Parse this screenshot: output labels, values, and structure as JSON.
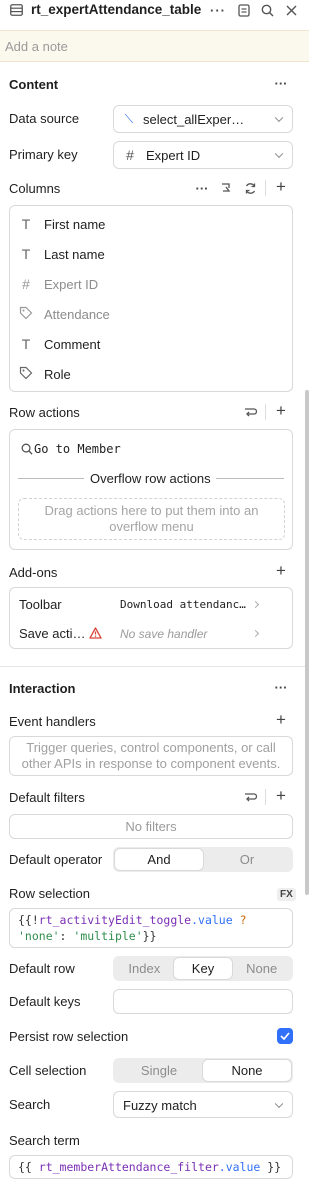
{
  "header": {
    "title": "rt_expertAttendance_table",
    "note_placeholder": "Add a note"
  },
  "content": {
    "section_title": "Content",
    "data_source": {
      "label": "Data source",
      "value": "select_allExper…"
    },
    "primary_key": {
      "label": "Primary key",
      "value": "Expert ID"
    },
    "columns": {
      "label": "Columns",
      "items": [
        {
          "type_icon": "T",
          "name": "First name",
          "muted": false
        },
        {
          "type_icon": "T",
          "name": "Last name",
          "muted": false
        },
        {
          "type_icon": "#",
          "name": "Expert ID",
          "muted": true
        },
        {
          "type_icon": "tag",
          "name": "Attendance",
          "muted": true
        },
        {
          "type_icon": "T",
          "name": "Comment",
          "muted": false
        },
        {
          "type_icon": "tag",
          "name": "Role",
          "muted": false
        }
      ]
    },
    "row_actions": {
      "label": "Row actions",
      "action": "Go to Member",
      "overflow_label": "Overflow row actions",
      "drop_hint": "Drag actions here to put them into an overflow menu"
    },
    "addons": {
      "label": "Add-ons",
      "toolbar": {
        "label": "Toolbar",
        "value": "Download attendanc…"
      },
      "save_actions": {
        "label": "Save acti…",
        "value": "No save handler"
      }
    }
  },
  "interaction": {
    "section_title": "Interaction",
    "event_handlers": {
      "label": "Event handlers",
      "hint": "Trigger queries, control components, or call other APIs in response to component events."
    },
    "default_filters": {
      "label": "Default filters",
      "value": "No filters"
    },
    "default_operator": {
      "label": "Default operator",
      "options": [
        "And",
        "Or"
      ],
      "selected": "And"
    },
    "row_selection": {
      "label": "Row selection",
      "fx": "FX",
      "code_line1_a": "{{!",
      "code_line1_b": "rt_activityEdit_toggle",
      "code_line1_c": ".value",
      "code_line1_d": " ?",
      "code_line2_a": "'none'",
      "code_line2_b": ": ",
      "code_line2_c": "'multiple'",
      "code_line2_d": "}}"
    },
    "default_row": {
      "label": "Default row",
      "options": [
        "Index",
        "Key",
        "None"
      ],
      "selected": "Key"
    },
    "default_keys": {
      "label": "Default keys",
      "value": ""
    },
    "persist_row_selection": {
      "label": "Persist row selection",
      "checked": true
    },
    "cell_selection": {
      "label": "Cell selection",
      "options": [
        "Single",
        "None"
      ],
      "selected": "None"
    },
    "search": {
      "label": "Search",
      "value": "Fuzzy match"
    },
    "search_term": {
      "label": "Search term",
      "code_a": "{{ ",
      "code_b": "rt_memberAttendance_filter",
      "code_c": ".value",
      "code_d": " }}"
    }
  },
  "colors": {
    "accent": "#3170f9",
    "note_bg": "#fbf8ee",
    "code_purple": "#7b2fb5",
    "code_green": "#2f8f4e",
    "code_orange": "#c9690c",
    "error_red": "#d8453a"
  }
}
